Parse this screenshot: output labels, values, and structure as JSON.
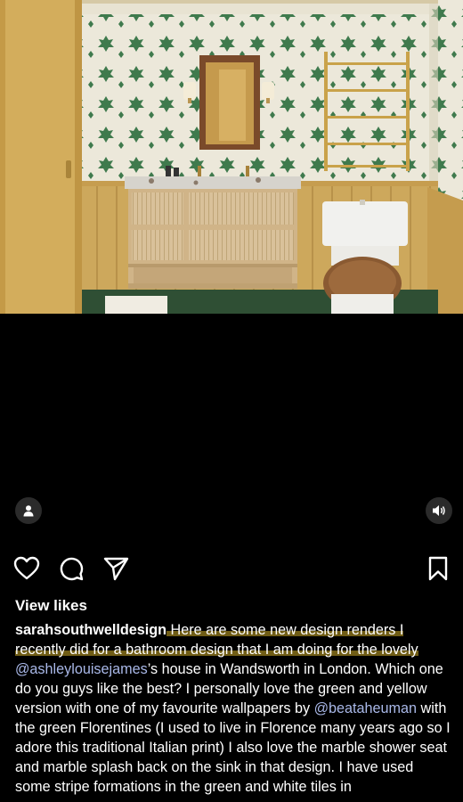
{
  "post": {
    "image_alt": "bathroom design render",
    "tag_icon": "person-tag-icon",
    "sound_icon": "speaker-icon"
  },
  "actions": {
    "like_icon": "heart-icon",
    "comment_icon": "comment-icon",
    "share_icon": "send-icon",
    "save_icon": "bookmark-icon"
  },
  "likes": {
    "label": "View likes"
  },
  "caption": {
    "username": "sarahsouthwelldesign",
    "part1": " Here are some new design renders I recently did for a bathroom design that I am doing for the lovely ",
    "mention1": "@ashleylouisejames",
    "part2": "’s house in Wandsworth in London. Which one do you guys like the best? I personally love the green and yellow version with one of my favourite wallpapers by ",
    "mention2": "@beataheuman",
    "part3": " with the green Florentines (I used to live in Florence many years ago so I adore this traditional Italian print) I also love the marble shower seat and marble splash back on the sink in that design. I have used some stripe formations in the green and white tiles in"
  },
  "colors": {
    "background": "#000000",
    "mention": "#a9b8e8",
    "wall_yellow": "#d7b463",
    "wallpaper_green": "#3f7a4d"
  }
}
